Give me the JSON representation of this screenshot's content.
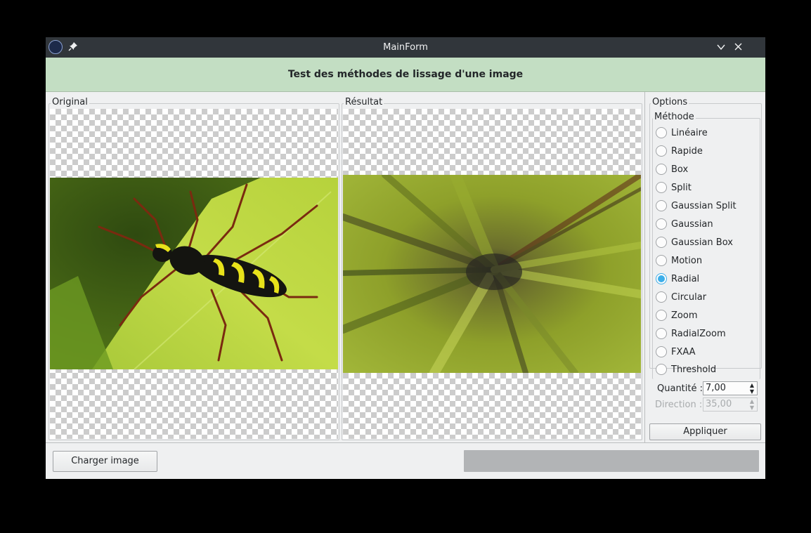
{
  "window": {
    "title": "MainForm"
  },
  "banner": {
    "text": "Test des méthodes de lissage d'une image"
  },
  "original": {
    "label": "Original"
  },
  "result": {
    "label": "Résultat"
  },
  "options": {
    "label": "Options",
    "method": {
      "label": "Méthode",
      "items": [
        "Linéaire",
        "Rapide",
        "Box",
        "Split",
        "Gaussian Split",
        "Gaussian",
        "Gaussian Box",
        "Motion",
        "Radial",
        "Circular",
        "Zoom",
        "RadialZoom",
        "FXAA",
        "Threshold"
      ],
      "selected": "Radial"
    },
    "quantity": {
      "label": "Quantité :",
      "value": "7,00"
    },
    "direction": {
      "label": "Direction :",
      "value": "35,00"
    },
    "apply_label": "Appliquer"
  },
  "footer": {
    "load_label": "Charger image",
    "progress": 0
  },
  "colors": {
    "banner_bg": "#c3dec3",
    "accent": "#3daee9",
    "titlebar": "#31363b"
  }
}
